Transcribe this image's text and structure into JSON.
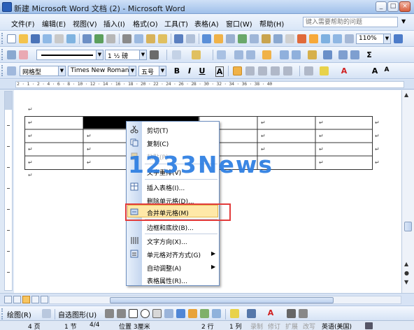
{
  "window": {
    "title": "新建 Microsoft Word 文档 (2) - Microsoft Word"
  },
  "menubar": {
    "items": [
      "文件(F)",
      "编辑(E)",
      "视图(V)",
      "插入(I)",
      "格式(O)",
      "工具(T)",
      "表格(A)",
      "窗口(W)",
      "帮助(H)"
    ],
    "help_placeholder": "键入需要帮助的问题"
  },
  "toolbar": {
    "zoom": "110%",
    "font_name": "Times New Roman",
    "font_size": "五号",
    "style": "网格型",
    "line_weight": "1 ½ 磅",
    "draw_label": "绘图(R)",
    "autoshape_label": "自选图形(U)"
  },
  "ruler": {
    "numbers": "2 · 1 · 2 · 4 · 6 · 8 · 10 · 12 · 14 · 16 · 18 · 20 · 22 · 24 · 26 · 28 · 30 · 32 · 34 · 36 · 38 · 40"
  },
  "context_menu": {
    "items": [
      {
        "label": "剪切(T)",
        "icon": "scissors-icon",
        "enabled": true
      },
      {
        "label": "复制(C)",
        "icon": "copy-icon",
        "enabled": true
      },
      {
        "label": "粘贴(P)",
        "icon": "paste-icon",
        "enabled": false
      },
      {
        "label": "文字重排(V)",
        "icon": "",
        "enabled": true
      },
      {
        "label": "插入表格(I)...",
        "icon": "insert-table-icon",
        "enabled": true
      },
      {
        "label": "删除单元格(D)...",
        "icon": "",
        "enabled": true
      },
      {
        "label": "合并单元格(M)",
        "icon": "merge-cells-icon",
        "enabled": true,
        "highlighted": true
      },
      {
        "label": "边框和底纹(B)...",
        "icon": "",
        "enabled": true
      },
      {
        "label": "文字方向(X)...",
        "icon": "text-direction-icon",
        "enabled": true
      },
      {
        "label": "单元格对齐方式(G)",
        "icon": "cell-align-icon",
        "enabled": true,
        "submenu": true
      },
      {
        "label": "自动调整(A)",
        "icon": "",
        "enabled": true,
        "submenu": true
      },
      {
        "label": "表格属性(R)...",
        "icon": "",
        "enabled": true
      }
    ]
  },
  "watermark": "1233News",
  "statusbar": {
    "page": "4 页",
    "section": "1 节",
    "page_of": "4/4",
    "position": "位置 3厘米",
    "line": "2 行",
    "column": "1 列",
    "rec": "录制",
    "trk": "修订",
    "ext": "扩展",
    "ovr": "改写",
    "language": "英语(美国)"
  },
  "colors": {
    "accent": "#2b7de2",
    "highlight": "#ffe8a8",
    "red_outline": "#e23b3b"
  }
}
